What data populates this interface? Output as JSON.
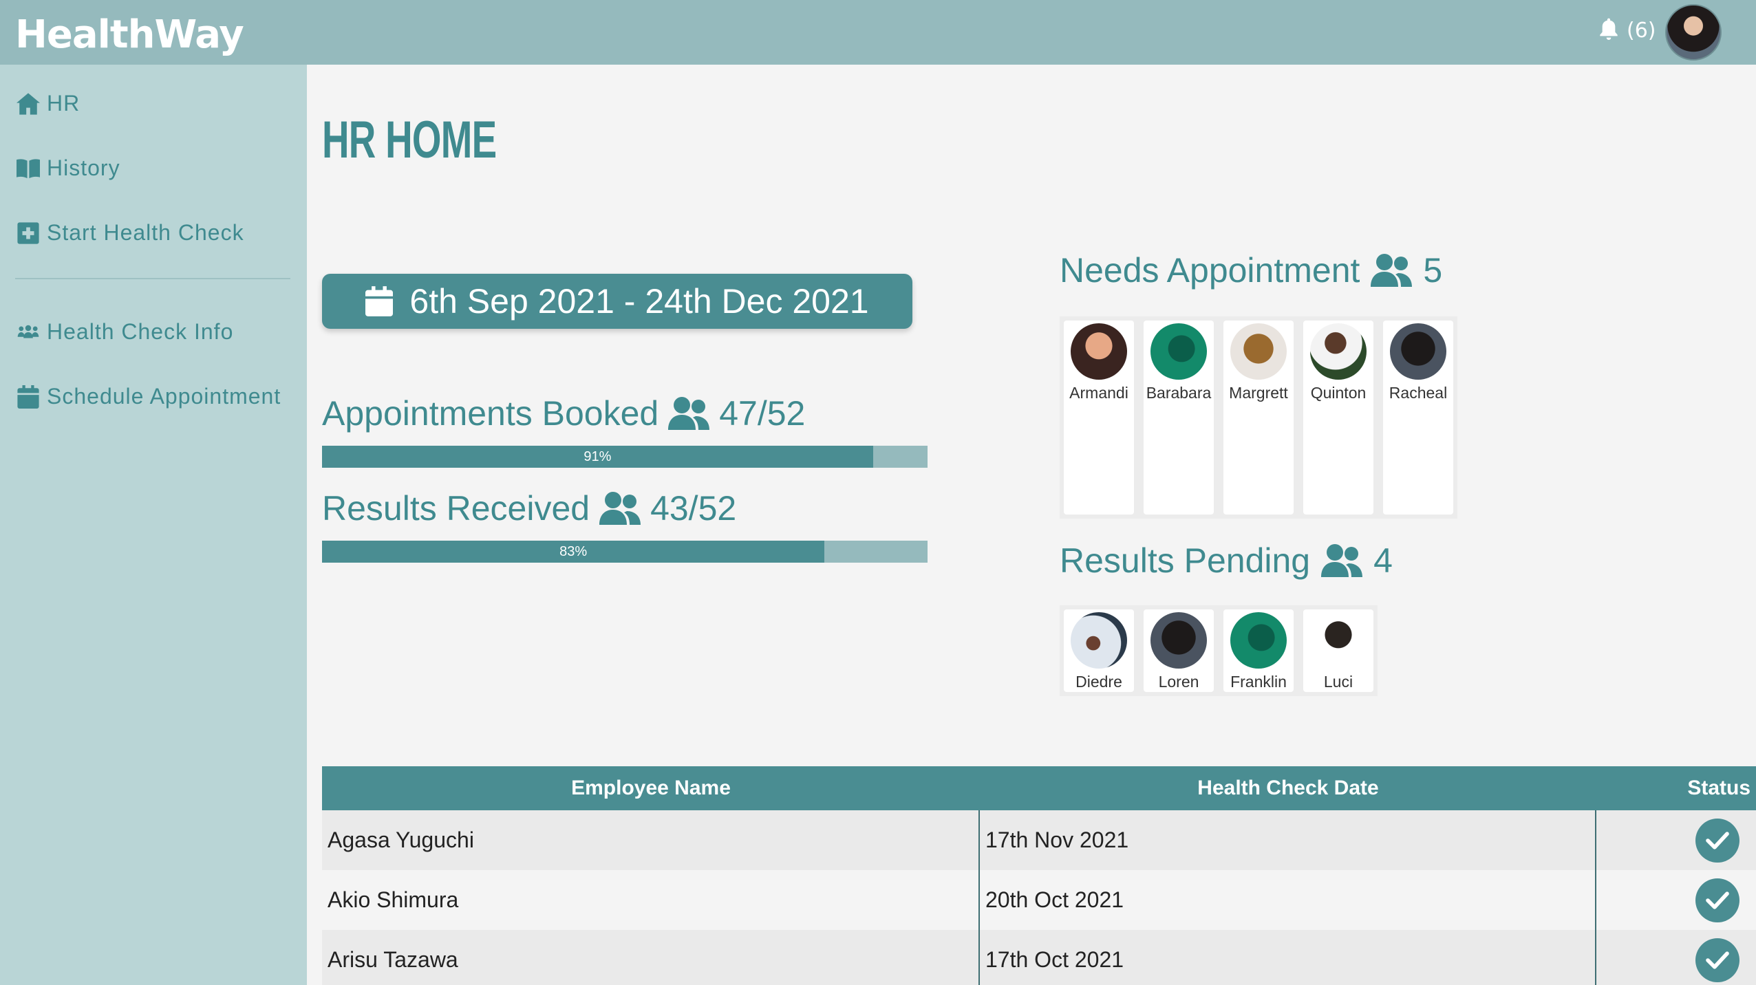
{
  "app": {
    "brand": "HealthWay",
    "notification_count": "(6)"
  },
  "sidebar": {
    "items": [
      {
        "label": "HR",
        "icon": "home-icon"
      },
      {
        "label": "History",
        "icon": "book-icon"
      },
      {
        "label": "Start Health Check",
        "icon": "plus-square-icon"
      },
      {
        "label": "Health Check Info",
        "icon": "users-icon"
      },
      {
        "label": "Schedule Appointment",
        "icon": "calendar-icon"
      }
    ]
  },
  "main": {
    "title": "HR HOME",
    "date_range": "6th Sep 2021 - 24th Dec 2021",
    "appointments": {
      "label": "Appointments Booked",
      "count": "47/52",
      "percent_text": "91%",
      "percent": 91
    },
    "results": {
      "label": "Results Received",
      "count": "43/52",
      "percent_text": "83%",
      "percent": 83
    }
  },
  "needs_appointment": {
    "label": "Needs Appointment",
    "count": "5",
    "people": [
      "Armandi",
      "Barabara",
      "Margrett",
      "Quinton",
      "Racheal"
    ]
  },
  "results_pending": {
    "label": "Results Pending",
    "count": "4",
    "people": [
      "Diedre",
      "Loren",
      "Franklin",
      "Luci"
    ]
  },
  "table": {
    "headers": [
      "Employee Name",
      "Health Check Date",
      "Status"
    ],
    "rows": [
      {
        "name": "Agasa Yuguchi",
        "date": "17th Nov 2021",
        "status": "complete"
      },
      {
        "name": "Akio Shimura",
        "date": "20th Oct 2021",
        "status": "complete"
      },
      {
        "name": "Arisu Tazawa",
        "date": "17th Oct 2021",
        "status": "complete"
      }
    ]
  },
  "colors": {
    "accent": "#4a8d92",
    "topbar": "#95babd",
    "sidebar": "#b9d5d6",
    "text_accent": "#3f8a8f"
  }
}
